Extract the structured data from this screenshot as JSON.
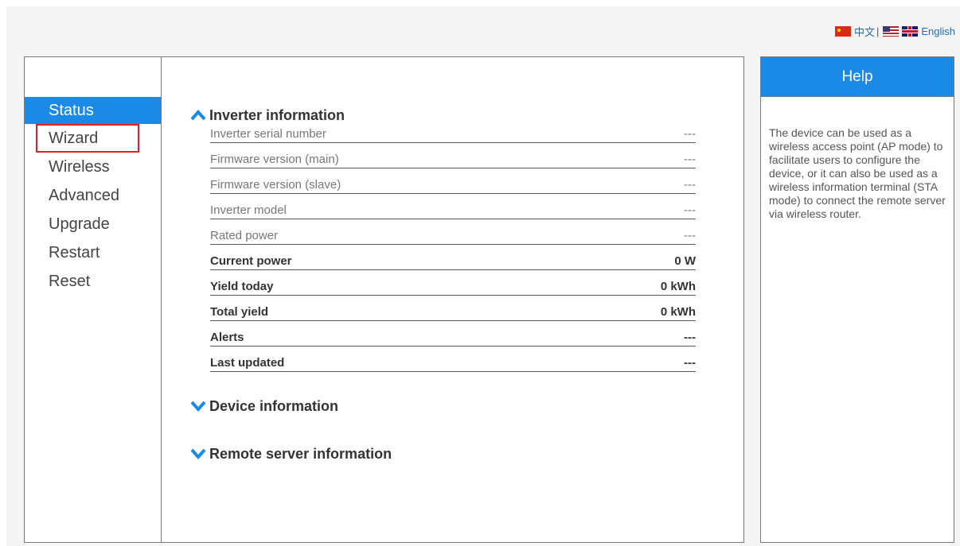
{
  "language": {
    "chinese_label": "中文",
    "separator": "|",
    "english_label": "English"
  },
  "sidebar": {
    "items": [
      {
        "label": "Status"
      },
      {
        "label": "Wizard"
      },
      {
        "label": "Wireless"
      },
      {
        "label": "Advanced"
      },
      {
        "label": "Upgrade"
      },
      {
        "label": "Restart"
      },
      {
        "label": "Reset"
      }
    ]
  },
  "main": {
    "inverter_section": {
      "title": "Inverter information",
      "rows": [
        {
          "label": "Inverter serial number",
          "value": "---"
        },
        {
          "label": "Firmware version (main)",
          "value": "---"
        },
        {
          "label": "Firmware version (slave)",
          "value": "---"
        },
        {
          "label": "Inverter model",
          "value": "---"
        },
        {
          "label": "Rated power",
          "value": "---"
        },
        {
          "label": "Current power",
          "value": "0 W"
        },
        {
          "label": "Yield today",
          "value": "0 kWh"
        },
        {
          "label": "Total yield",
          "value": "0 kWh"
        },
        {
          "label": "Alerts",
          "value": "---"
        },
        {
          "label": "Last updated",
          "value": "---"
        }
      ]
    },
    "device_section": {
      "title": "Device information"
    },
    "remote_section": {
      "title": "Remote server information"
    }
  },
  "help": {
    "title": "Help",
    "text": "The device can be used as a wireless access point (AP mode) to facilitate users to configure the device, or it can also be used as a wireless information terminal (STA mode) to connect the remote server via wireless router."
  },
  "colors": {
    "accent": "#1a8ae6",
    "highlight_border": "#e02020"
  }
}
